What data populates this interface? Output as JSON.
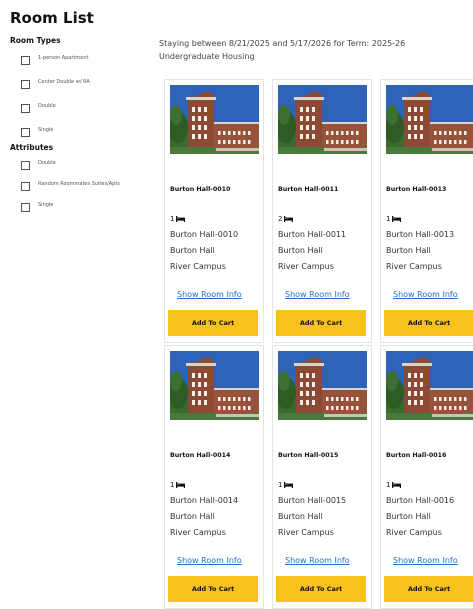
{
  "page": {
    "title": "Room List"
  },
  "filters": {
    "room_types_title": "Room Types",
    "room_types": [
      "1-person Apartment",
      "Center Double w/ RA",
      "Double",
      "Single"
    ],
    "attributes_title": "Attributes",
    "attributes": [
      "Double",
      "Random Roommates Suites/Apts",
      "Single"
    ]
  },
  "stay_text": "Staying between 8/21/2025 and 5/17/2026 for Term: 2025-26 Undergraduate Housing",
  "rooms": [
    {
      "name": "Burton Hall-0010",
      "beds": "1",
      "room": "Burton Hall-0010",
      "hall": "Burton Hall",
      "campus": "River Campus"
    },
    {
      "name": "Burton Hall-0011",
      "beds": "2",
      "room": "Burton Hall-0011",
      "hall": "Burton Hall",
      "campus": "River Campus"
    },
    {
      "name": "Burton Hall-0013",
      "beds": "1",
      "room": "Burton Hall-0013",
      "hall": "Burton Hall",
      "campus": "River Campus"
    },
    {
      "name": "Burton Hall-0014",
      "beds": "1",
      "room": "Burton Hall-0014",
      "hall": "Burton Hall",
      "campus": "River Campus"
    },
    {
      "name": "Burton Hall-0015",
      "beds": "1",
      "room": "Burton Hall-0015",
      "hall": "Burton Hall",
      "campus": "River Campus"
    },
    {
      "name": "Burton Hall-0016",
      "beds": "1",
      "room": "Burton Hall-0016",
      "hall": "Burton Hall",
      "campus": "River Campus"
    }
  ],
  "labels": {
    "show_info": "Show Room Info",
    "add_to_cart": "Add To Cart"
  },
  "icons": {
    "bed": "bed-icon",
    "checkbox": "checkbox-icon"
  },
  "colors": {
    "accent_button": "#f6c21b",
    "link": "#2b6cc4",
    "sky": "#2f63b8",
    "brick": "#8c4a34"
  }
}
